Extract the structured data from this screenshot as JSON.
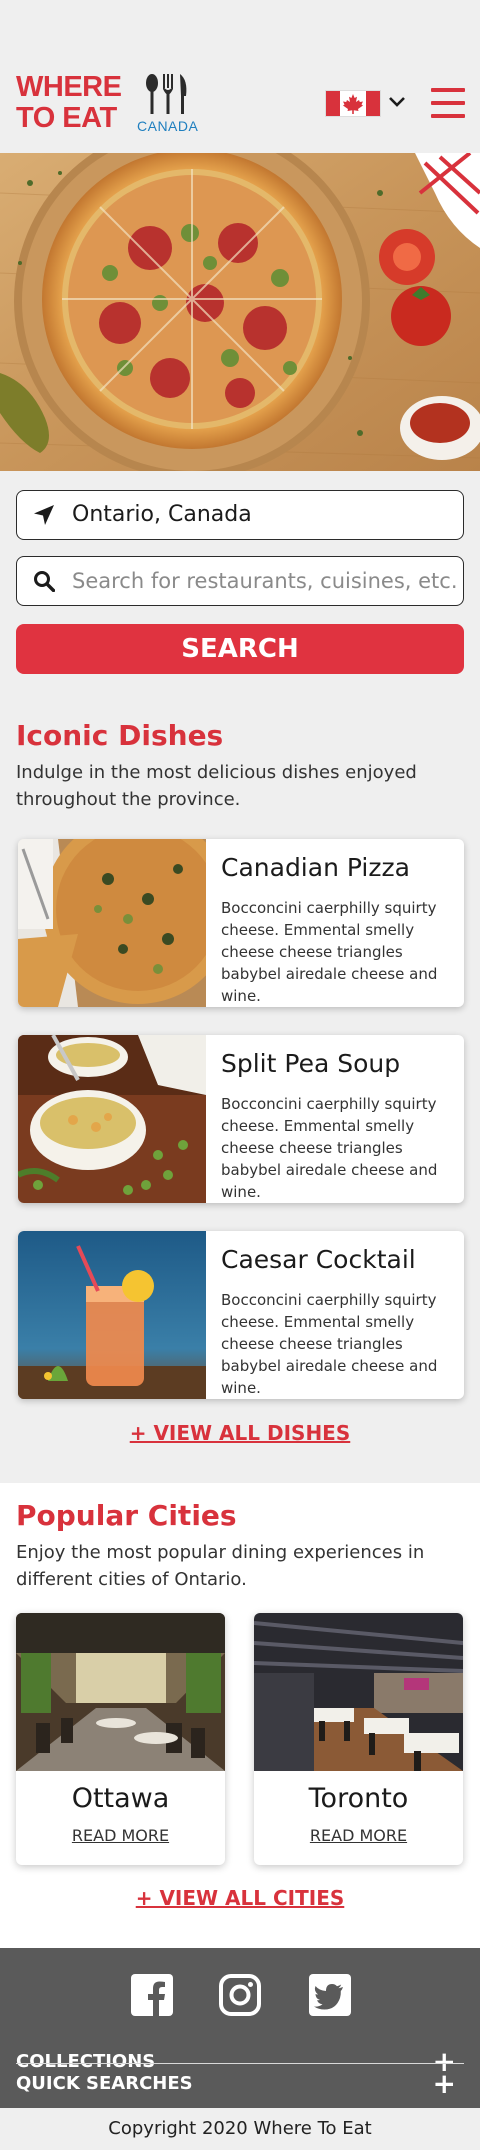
{
  "header": {
    "logo_line1": "WHERE",
    "logo_line2": "TO EAT",
    "logo_country": "CANADA",
    "country_flag": "canada-flag-icon",
    "menu_icon": "hamburger-menu-icon"
  },
  "hero": {
    "image": "pizza-hero-image"
  },
  "search": {
    "location_value": "Ontario, Canada",
    "location_icon": "location-arrow-icon",
    "query_placeholder": "Search for restaurants, cuisines, etc.",
    "query_icon": "search-icon",
    "button_label": "SEARCH"
  },
  "iconic_dishes": {
    "title": "Iconic Dishes",
    "description": "Indulge in the most delicious dishes enjoyed throughout the province.",
    "items": [
      {
        "name": "Canadian Pizza",
        "description": "Bocconcini caerphilly squirty cheese. Emmental smelly cheese cheese triangles babybel airedale cheese and wine."
      },
      {
        "name": "Split Pea Soup",
        "description": "Bocconcini caerphilly squirty cheese. Emmental smelly cheese cheese triangles babybel airedale cheese and wine."
      },
      {
        "name": "Caesar Cocktail",
        "description": "Bocconcini caerphilly squirty cheese. Emmental smelly cheese cheese triangles babybel airedale cheese and wine."
      }
    ],
    "view_all": "+ VIEW ALL DISHES"
  },
  "popular_cities": {
    "title": "Popular Cities",
    "description": "Enjoy the most popular dining experiences in different cities of Ontario.",
    "items": [
      {
        "name": "Ottawa",
        "link": "READ MORE"
      },
      {
        "name": "Toronto",
        "link": "READ MORE"
      }
    ],
    "view_all": "+ VIEW ALL CITIES"
  },
  "footer": {
    "social": [
      "facebook-icon",
      "instagram-icon",
      "twitter-icon"
    ],
    "sections": [
      {
        "label": "COLLECTIONS",
        "toggle": "+"
      },
      {
        "label": "QUICK SEARCHES",
        "toggle": "+"
      }
    ],
    "copyright": "Copyright 2020  Where To Eat"
  },
  "colors": {
    "brand_red": "#d8323c",
    "button_red": "#e03340",
    "logo_blue": "#1f7fbf",
    "footer_gray": "#5a5a5a"
  }
}
